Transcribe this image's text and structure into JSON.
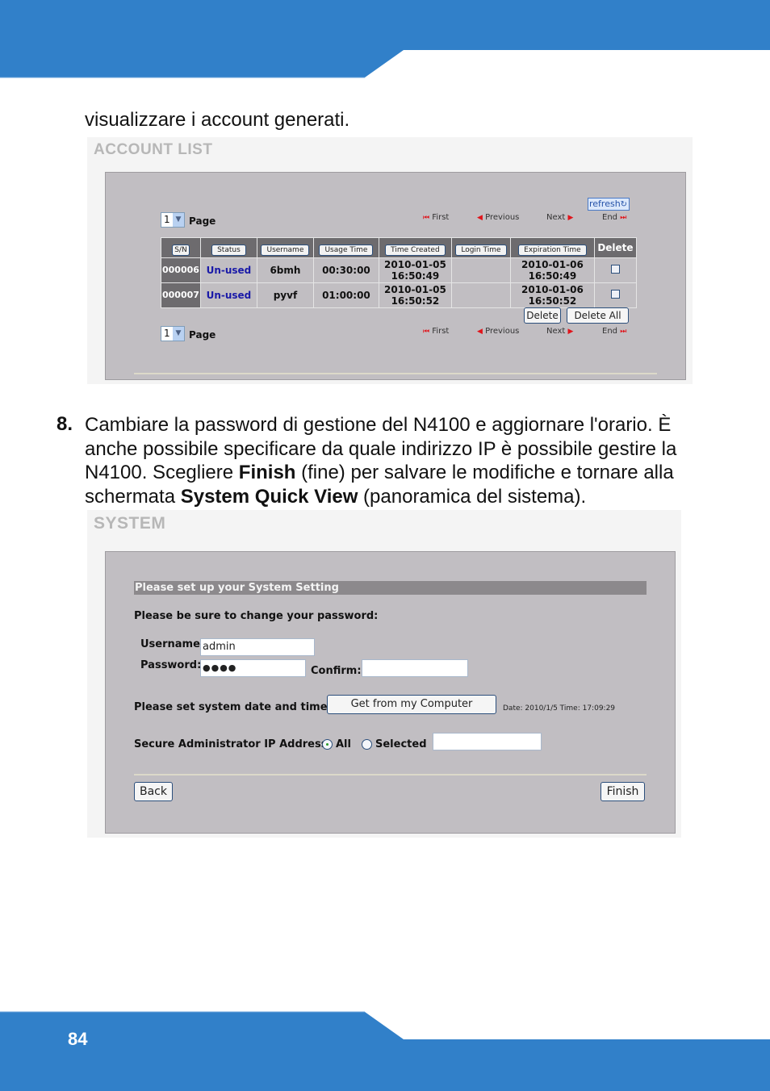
{
  "document": {
    "page_number": "84",
    "intro_text": "visualizzare i account generati.",
    "brand_color": "#3180c9",
    "step": {
      "number": "8.",
      "text_parts": [
        "Cambiare la password di gestione del N4100 e aggiornare l'orario. È anche possibile specificare da quale indirizzo IP è possibile gestire la N4100. Scegliere ",
        "Finish",
        " (fine) per salvare le modifiche e tornare alla schermata ",
        "System Quick View",
        " (panoramica del sistema)."
      ]
    }
  },
  "account_list": {
    "title": "ACCOUNT LIST",
    "refresh_label": "refresh",
    "page_select_value": "1",
    "page_label": "Page",
    "nav": {
      "first": "First",
      "previous": "Previous",
      "next": "Next",
      "end": "End"
    },
    "columns": [
      "S/N",
      "Status",
      "Username",
      "Usage Time",
      "Time Created",
      "Login Time",
      "Expiration Time",
      "Delete"
    ],
    "rows": [
      {
        "sn": "000006",
        "status": "Un-used",
        "username": "6bmh",
        "usage_time": "00:30:00",
        "time_created_date": "2010-01-05",
        "time_created_time": "16:50:49",
        "login_time": "",
        "expiration_date": "2010-01-06",
        "expiration_time": "16:50:49",
        "delete_checked": false
      },
      {
        "sn": "000007",
        "status": "Un-used",
        "username": "pyvf",
        "usage_time": "01:00:00",
        "time_created_date": "2010-01-05",
        "time_created_time": "16:50:52",
        "login_time": "",
        "expiration_date": "2010-01-06",
        "expiration_time": "16:50:52",
        "delete_checked": false
      }
    ],
    "delete_button": "Delete",
    "delete_all_button": "Delete All"
  },
  "system": {
    "title": "SYSTEM",
    "header_bar": "Please set up your System Setting",
    "password_prompt": "Please be sure to change your password:",
    "username_label": "Username:",
    "username_value": "admin",
    "password_label": "Password:",
    "password_value": "●●●●",
    "confirm_label": "Confirm:",
    "confirm_value": "",
    "datetime_label": "Please set system date and time:",
    "get_from_computer_button": "Get from my Computer",
    "current_datetime": "Date: 2010/1/5 Time: 17:09:29",
    "secure_ip_label": "Secure Administrator IP Address",
    "radio_all": "All",
    "radio_selected": "Selected",
    "radio_value": "All",
    "ip_value": "",
    "back_button": "Back",
    "finish_button": "Finish"
  }
}
